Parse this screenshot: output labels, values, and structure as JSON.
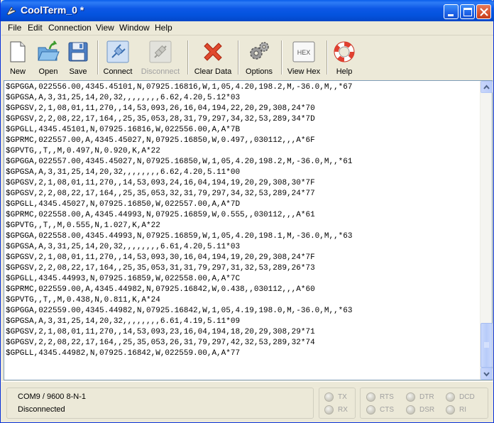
{
  "window": {
    "title": "CoolTerm_0 *"
  },
  "menu": [
    {
      "label": "File"
    },
    {
      "label": "Edit"
    },
    {
      "label": "Connection"
    },
    {
      "label": "View"
    },
    {
      "label": "Window"
    },
    {
      "label": "Help"
    }
  ],
  "toolbar": {
    "new": {
      "label": "New",
      "icon": "new-document-icon"
    },
    "open": {
      "label": "Open",
      "icon": "open-folder-icon"
    },
    "save": {
      "label": "Save",
      "icon": "floppy-disk-icon"
    },
    "connect": {
      "label": "Connect",
      "icon": "connect-plug-icon"
    },
    "disconnect": {
      "label": "Disconnect",
      "icon": "disconnect-plug-icon",
      "enabled": false
    },
    "clear": {
      "label": "Clear Data",
      "icon": "red-x-icon"
    },
    "options": {
      "label": "Options",
      "icon": "gears-icon"
    },
    "viewhex": {
      "label": "View Hex",
      "icon": "hex-icon",
      "icon_text": "HEX"
    },
    "help": {
      "label": "Help",
      "icon": "lifebuoy-icon"
    }
  },
  "terminal": {
    "lines": [
      "$GPGGA,022556.00,4345.45101,N,07925.16816,W,1,05,4.20,198.2,M,-36.0,M,,*67",
      "$GPGSA,A,3,31,25,14,20,32,,,,,,,,6.62,4.20,5.12*03",
      "$GPGSV,2,1,08,01,11,270,,14,53,093,26,16,04,194,22,20,29,308,24*70",
      "$GPGSV,2,2,08,22,17,164,,25,35,053,28,31,79,297,34,32,53,289,34*7D",
      "$GPGLL,4345.45101,N,07925.16816,W,022556.00,A,A*7B",
      "$GPRMC,022557.00,A,4345.45027,N,07925.16850,W,0.497,,030112,,,A*6F",
      "$GPVTG,,T,,M,0.497,N,0.920,K,A*22",
      "$GPGGA,022557.00,4345.45027,N,07925.16850,W,1,05,4.20,198.2,M,-36.0,M,,*61",
      "$GPGSA,A,3,31,25,14,20,32,,,,,,,,6.62,4.20,5.11*00",
      "$GPGSV,2,1,08,01,11,270,,14,53,093,24,16,04,194,19,20,29,308,30*7F",
      "$GPGSV,2,2,08,22,17,164,,25,35,053,32,31,79,297,34,32,53,289,24*77",
      "$GPGLL,4345.45027,N,07925.16850,W,022557.00,A,A*7D",
      "$GPRMC,022558.00,A,4345.44993,N,07925.16859,W,0.555,,030112,,,A*61",
      "$GPVTG,,T,,M,0.555,N,1.027,K,A*22",
      "$GPGGA,022558.00,4345.44993,N,07925.16859,W,1,05,4.20,198.1,M,-36.0,M,,*63",
      "$GPGSA,A,3,31,25,14,20,32,,,,,,,,6.61,4.20,5.11*03",
      "$GPGSV,2,1,08,01,11,270,,14,53,093,30,16,04,194,19,20,29,308,24*7F",
      "$GPGSV,2,2,08,22,17,164,,25,35,053,31,31,79,297,31,32,53,289,26*73",
      "$GPGLL,4345.44993,N,07925.16859,W,022558.00,A,A*7C",
      "$GPRMC,022559.00,A,4345.44982,N,07925.16842,W,0.438,,030112,,,A*60",
      "$GPVTG,,T,,M,0.438,N,0.811,K,A*24",
      "$GPGGA,022559.00,4345.44982,N,07925.16842,W,1,05,4.19,198.0,M,-36.0,M,,*63",
      "$GPGSA,A,3,31,25,14,20,32,,,,,,,,6.61,4.19,5.11*09",
      "$GPGSV,2,1,08,01,11,270,,14,53,093,23,16,04,194,18,20,29,308,29*71",
      "$GPGSV,2,2,08,22,17,164,,25,35,053,26,31,79,297,42,32,53,289,32*74",
      "$GPGLL,4345.44982,N,07925.16842,W,022559.00,A,A*77"
    ]
  },
  "status": {
    "port": "COM9 / 9600 8-N-1",
    "connection": "Disconnected"
  },
  "leds": {
    "tx": "TX",
    "rx": "RX",
    "rts": "RTS",
    "cts": "CTS",
    "dtr": "DTR",
    "dsr": "DSR",
    "dcd": "DCD",
    "ri": "RI"
  }
}
